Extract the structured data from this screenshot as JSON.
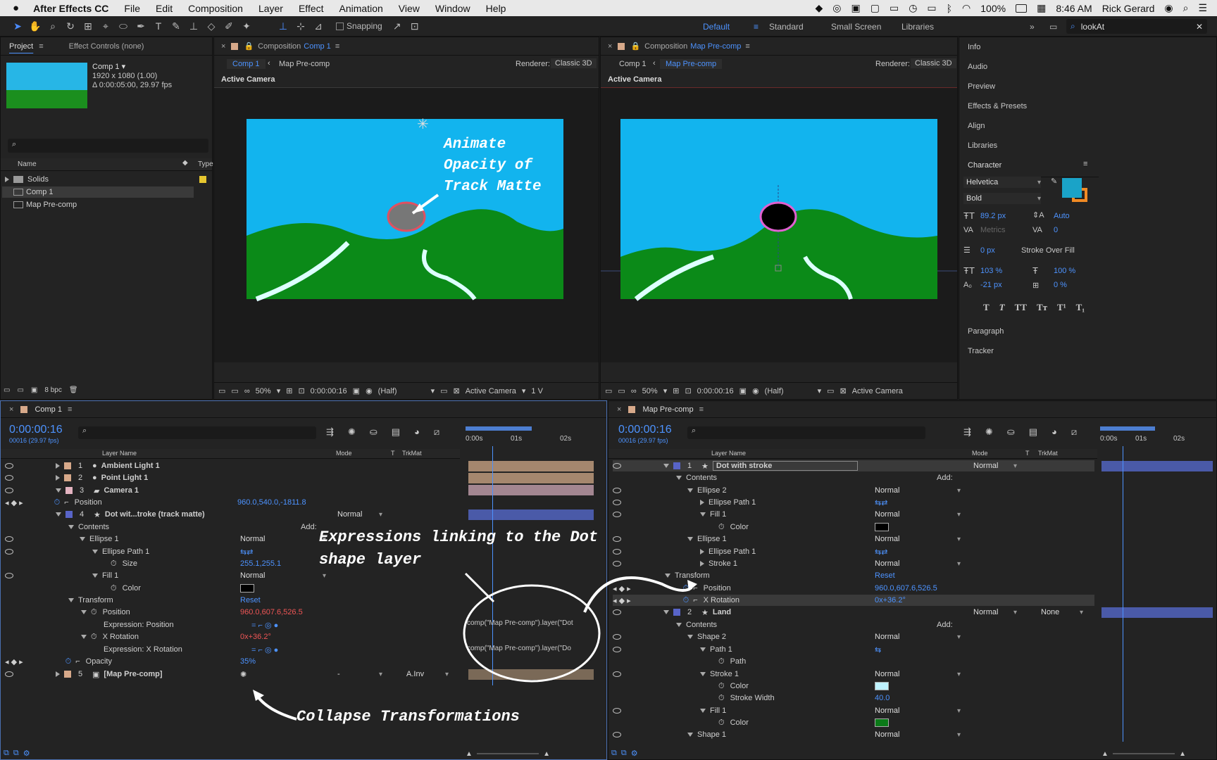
{
  "menubar": {
    "app": "After Effects CC",
    "items": [
      "File",
      "Edit",
      "Composition",
      "Layer",
      "Effect",
      "Animation",
      "View",
      "Window",
      "Help"
    ],
    "battery": "100%",
    "time": "8:46 AM",
    "user": "Rick Gerard"
  },
  "toolbar": {
    "snapping": "Snapping",
    "workspaces": [
      "Default",
      "Standard",
      "Small Screen",
      "Libraries"
    ],
    "search_value": "lookAt"
  },
  "project": {
    "tab": "Project",
    "effect_controls": "Effect Controls (none)",
    "comp_name": "Comp 1 ▾",
    "comp_size": "1920 x 1080 (1.00)",
    "comp_duration": "Δ 0:00:05:00, 29.97 fps",
    "col_name": "Name",
    "col_type": "Type",
    "items": [
      {
        "name": "Solids",
        "type": "F"
      },
      {
        "name": "Comp 1",
        "type": "C"
      },
      {
        "name": "Map Pre-comp",
        "type": "C"
      }
    ],
    "bpc": "8 bpc"
  },
  "viewer1": {
    "title_prefix": "Composition",
    "title_comp": "Comp 1",
    "crumb1": "Comp 1",
    "crumb2": "Map Pre-comp",
    "renderer_label": "Renderer:",
    "renderer": "Classic 3D",
    "camera_label": "Active Camera",
    "annotation": [
      "Animate",
      "Opacity of",
      "Track Matte"
    ],
    "zoom": "50%",
    "time": "0:00:00:16",
    "res": "(Half)",
    "view": "Active Camera",
    "views": "1 V"
  },
  "viewer2": {
    "title_prefix": "Composition",
    "title_comp": "Map Pre-comp",
    "crumb1": "Comp 1",
    "crumb2": "Map Pre-comp",
    "renderer_label": "Renderer:",
    "renderer": "Classic 3D",
    "camera_label": "Active Camera",
    "zoom": "50%",
    "time": "0:00:00:16",
    "res": "(Half)",
    "view": "Active Camera"
  },
  "right_panel": {
    "items": [
      "Info",
      "Audio",
      "Preview",
      "Effects & Presets",
      "Align",
      "Libraries"
    ],
    "character": "Character",
    "font": "Helvetica",
    "style": "Bold",
    "size": "89.2 px",
    "leading": "Auto",
    "kerning": "Metrics",
    "tracking": "0",
    "stroke_width": "0 px",
    "stroke_type": "Stroke Over Fill",
    "vscale": "103 %",
    "hscale": "100 %",
    "baseline": "-21 px",
    "tsume": "0 %",
    "text_styles": [
      "T",
      "T",
      "TT",
      "Tт",
      "T¹",
      "T₁"
    ],
    "paragraph": "Paragraph",
    "tracker": "Tracker",
    "fill_color": "#1aa3c8",
    "stroke_color": "#f08a24"
  },
  "timeline1": {
    "tab": "Comp 1",
    "time": "0:00:00:16",
    "fps": "00016 (29.97 fps)",
    "ruler": [
      "0:00s",
      "01s",
      "02s"
    ],
    "col_layer_name": "Layer Name",
    "col_mode": "Mode",
    "col_t": "T",
    "col_trkmat": "TrkMat",
    "rows": [
      {
        "num": "1",
        "name": "Ambient Light 1",
        "color": "#d7a98a"
      },
      {
        "num": "2",
        "name": "Point Light 1",
        "color": "#d7a98a"
      },
      {
        "num": "3",
        "name": "Camera 1",
        "color": "#e3b3c0"
      },
      {
        "label": "Position",
        "value": "960.0,540.0,-1811.8"
      },
      {
        "num": "4",
        "name": "Dot wit...troke (track matte)",
        "mode": "Normal",
        "color": "#5864c8"
      },
      {
        "label": "Contents",
        "add": "Add:"
      },
      {
        "label": "Ellipse 1",
        "value": "Normal"
      },
      {
        "label": "Ellipse Path 1"
      },
      {
        "label": "Size",
        "value": "255.1,255.1"
      },
      {
        "label": "Fill 1",
        "value": "Normal"
      },
      {
        "label": "Color"
      },
      {
        "label": "Transform",
        "value": "Reset"
      },
      {
        "label": "Position",
        "value": "960.0,607.6,526.5"
      },
      {
        "label": "Expression: Position"
      },
      {
        "label": "X Rotation",
        "value": "0x+36.2°"
      },
      {
        "label": "Expression: X Rotation"
      },
      {
        "label": "Opacity",
        "value": "35%"
      },
      {
        "num": "5",
        "name": "[Map Pre-comp]",
        "mode": "-",
        "trkmat": "A.Inv",
        "color": "#d7a98a"
      }
    ],
    "expr1": "comp(\"Map Pre-comp\").layer(\"Dot",
    "expr2": "comp(\"Map Pre-comp\").layer(\"Do",
    "annotation_expr": [
      "Expressions linking to the Dot",
      "shape layer"
    ],
    "annotation_collapse": "Collapse Transformations"
  },
  "timeline2": {
    "tab": "Map Pre-comp",
    "time": "0:00:00:16",
    "fps": "00016 (29.97 fps)",
    "ruler": [
      "0:00s",
      "01s",
      "02s"
    ],
    "col_layer_name": "Layer Name",
    "col_mode": "Mode",
    "col_t": "T",
    "col_trkmat": "TrkMat",
    "rows": [
      {
        "num": "1",
        "name": "Dot with stroke",
        "mode": "Normal"
      },
      {
        "label": "Contents",
        "add": "Add:"
      },
      {
        "label": "Ellipse 2",
        "value": "Normal"
      },
      {
        "label": "Ellipse Path 1"
      },
      {
        "label": "Fill 1",
        "value": "Normal"
      },
      {
        "label": "Color"
      },
      {
        "label": "Ellipse 1",
        "value": "Normal"
      },
      {
        "label": "Ellipse Path 1"
      },
      {
        "label": "Stroke 1",
        "value": "Normal"
      },
      {
        "label": "Transform",
        "value": "Reset"
      },
      {
        "label": "Position",
        "value": "960.0,607.6,526.5"
      },
      {
        "label": "X Rotation",
        "value": "0x+36.2°"
      },
      {
        "num": "2",
        "name": "Land",
        "mode": "Normal",
        "trkmat": "None"
      },
      {
        "label": "Contents",
        "add": "Add:"
      },
      {
        "label": "Shape 2",
        "value": "Normal"
      },
      {
        "label": "Path 1"
      },
      {
        "label": "Path"
      },
      {
        "label": "Stroke 1",
        "value": "Normal"
      },
      {
        "label": "Color"
      },
      {
        "label": "Stroke Width",
        "value": "40.0"
      },
      {
        "label": "Fill 1",
        "value": "Normal"
      },
      {
        "label": "Color"
      },
      {
        "label": "Shape 1",
        "value": "Normal"
      }
    ]
  }
}
